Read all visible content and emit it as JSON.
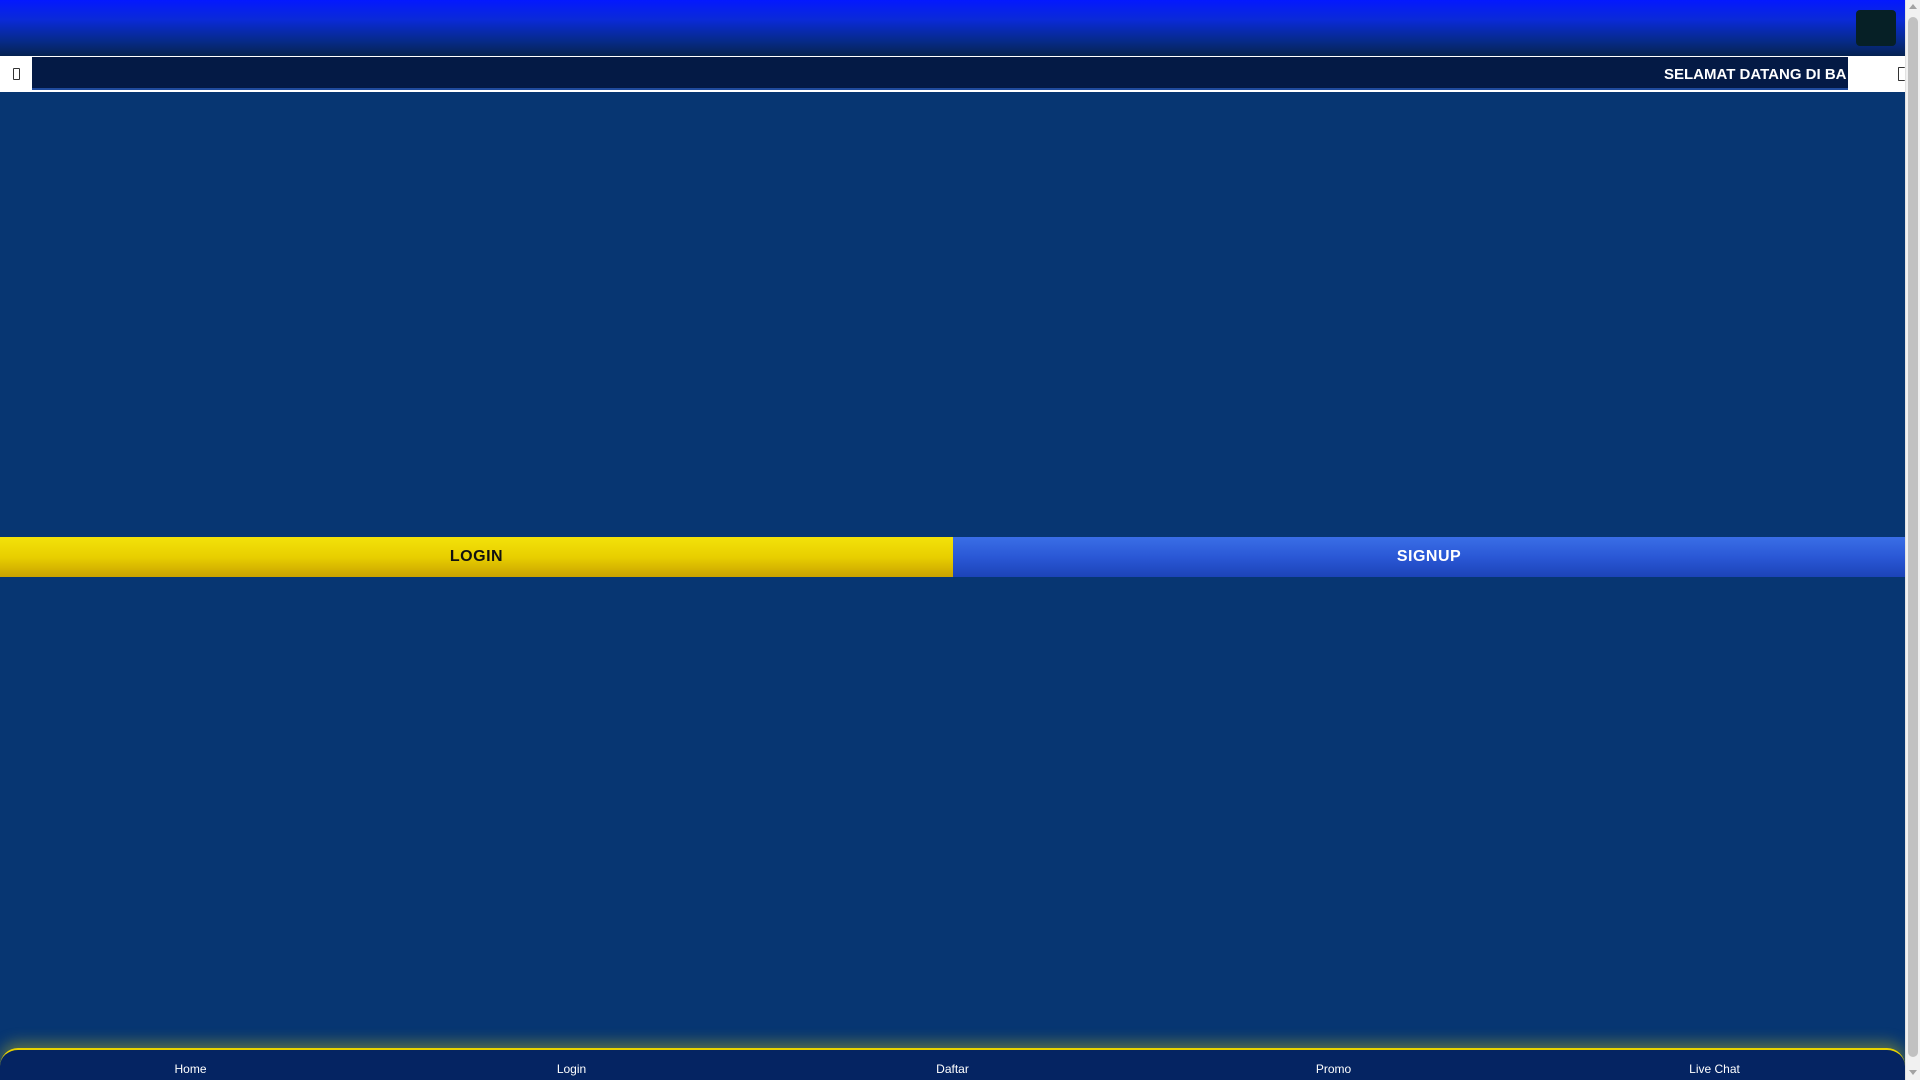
{
  "header": {
    "menu_icon": "hamburger-icon"
  },
  "marquee": {
    "text": "SELAMAT DATANG DI BA",
    "left_icon": "announcement-icon",
    "right_icon": "announcement-end-icon"
  },
  "auth": {
    "login_label": "LOGIN",
    "signup_label": "SIGNUP"
  },
  "bottom_nav": {
    "items": [
      {
        "label": "Home"
      },
      {
        "label": "Login"
      },
      {
        "label": "Daftar"
      },
      {
        "label": "Promo"
      },
      {
        "label": "Live Chat"
      }
    ]
  },
  "colors": {
    "background": "#073672",
    "header_top": "#0318ff",
    "login_yellow": "#e8cf00",
    "signup_blue": "#2a58d6",
    "nav_glow": "#e8d300"
  }
}
